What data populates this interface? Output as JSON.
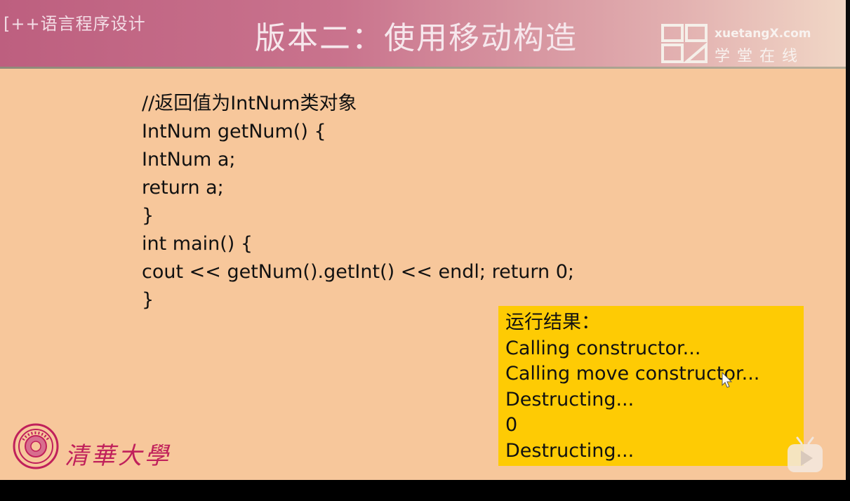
{
  "header": {
    "course_name": "[++语言程序设计",
    "title": "版本二：使用移动构造",
    "logo": {
      "en_text": "xuetangX.com",
      "cn_text": "学堂在线"
    }
  },
  "code_lines": [
    "//返回值为IntNum类对象",
    "IntNum getNum() {",
    "IntNum a;",
    "return a;",
    "}",
    "int main() {",
    "cout << getNum().getInt() << endl; return 0;",
    "}"
  ],
  "result": {
    "title": "运行结果：",
    "lines": [
      "Calling constructor...",
      "Calling move constructor...",
      "Destructing...",
      "0",
      "Destructing..."
    ]
  },
  "footer": {
    "university_name": "清華大學"
  },
  "icons": {
    "logo": "xuetangx-logo-icon",
    "seal": "university-seal-icon",
    "play": "play-icon",
    "cursor": "mouse-cursor-icon"
  },
  "colors": {
    "slide_background": "#f7c79b",
    "header_left": "#bd5f7f",
    "result_box": "#fecb04",
    "university_red": "#c0205b"
  }
}
